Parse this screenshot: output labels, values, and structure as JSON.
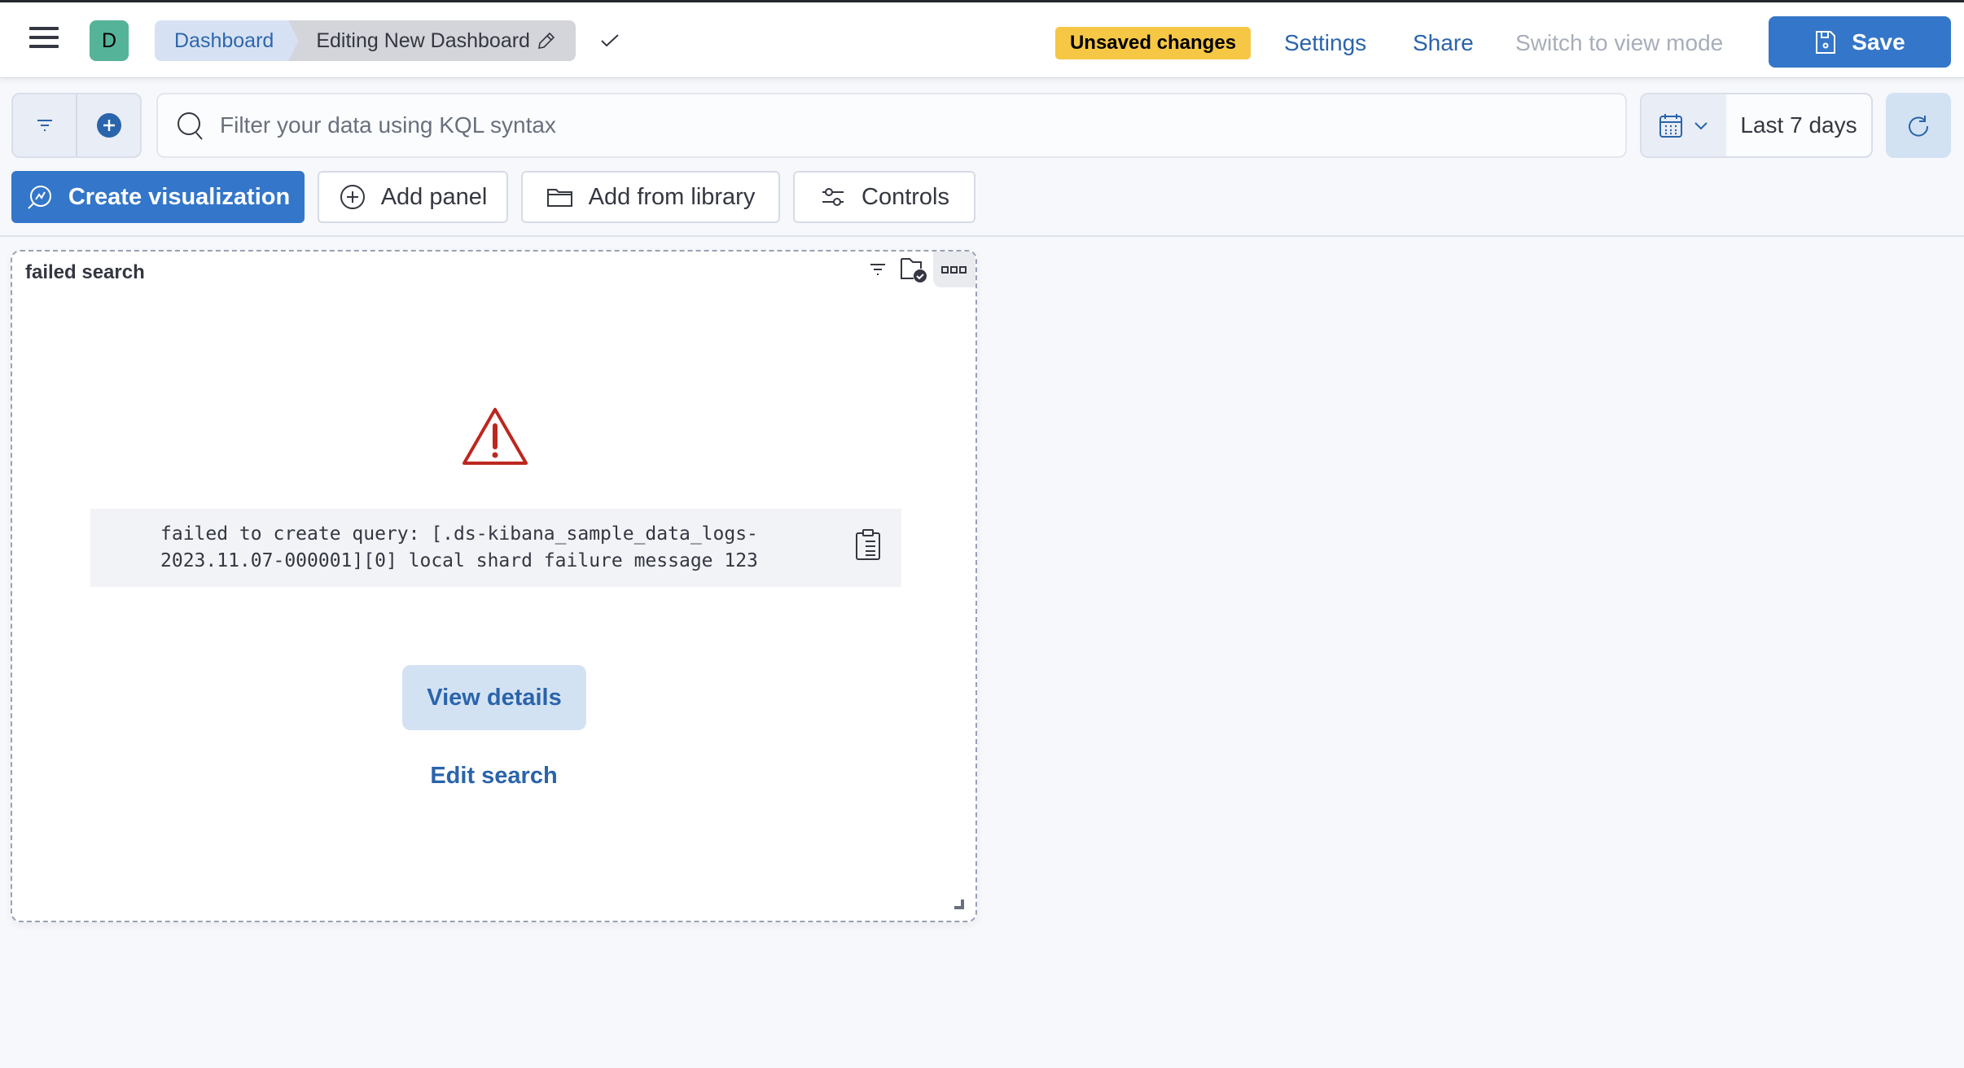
{
  "header": {
    "avatar_initial": "D",
    "breadcrumbs": [
      {
        "label": "Dashboard"
      },
      {
        "label": "Editing New Dashboard"
      }
    ],
    "unsaved_badge": "Unsaved changes",
    "settings_label": "Settings",
    "share_label": "Share",
    "switch_mode_label": "Switch to view mode",
    "save_label": "Save"
  },
  "query_bar": {
    "search_placeholder": "Filter your data using KQL syntax",
    "search_value": "",
    "time_range": "Last 7 days"
  },
  "toolbar": {
    "create_visualization": "Create visualization",
    "add_panel": "Add panel",
    "add_from_library": "Add from library",
    "controls": "Controls"
  },
  "panel": {
    "title": "failed search",
    "error_message": "failed to create query: [.ds-kibana_sample_data_logs-2023.11.07-000001][0] local shard failure message 123",
    "view_details_label": "View details",
    "edit_search_label": "Edit search"
  },
  "colors": {
    "primary": "#3476c9",
    "link": "#2a64ab",
    "warning_badge": "#f5c745",
    "danger": "#bd271e",
    "avatar": "#54b399"
  }
}
